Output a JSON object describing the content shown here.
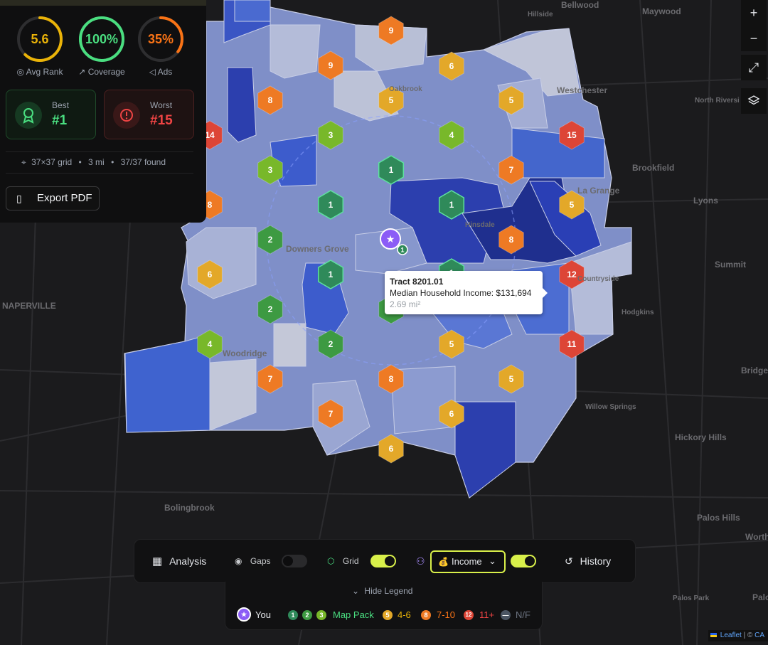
{
  "map": {
    "place_labels": [
      {
        "text": "Bellwood",
        "small": false
      },
      {
        "text": "Maywood",
        "small": false
      },
      {
        "text": "Hillside",
        "small": true
      },
      {
        "text": "Westchester",
        "small": false
      },
      {
        "text": "North Riversi",
        "small": true
      },
      {
        "text": "Brookfield",
        "small": false
      },
      {
        "text": "La Grange",
        "small": false
      },
      {
        "text": "Lyons",
        "small": false
      },
      {
        "text": "Summit",
        "small": false
      },
      {
        "text": "Hodgkins",
        "small": true
      },
      {
        "text": "NAPERVILLE",
        "small": false
      },
      {
        "text": "Bridgeview",
        "small": false
      },
      {
        "text": "Willow Springs",
        "small": true
      },
      {
        "text": "Hickory Hills",
        "small": false
      },
      {
        "text": "Bolingbrook",
        "small": false
      },
      {
        "text": "Palos Hills",
        "small": false
      },
      {
        "text": "Worth",
        "small": false
      },
      {
        "text": "Palos Park",
        "small": true
      },
      {
        "text": "Palos He",
        "small": false
      },
      {
        "text": "Downers Grove",
        "small": false
      },
      {
        "text": "Woodridge",
        "small": false
      },
      {
        "text": "Oakbrook",
        "small": true
      },
      {
        "text": "Countryside",
        "small": true
      },
      {
        "text": "Hinsdale",
        "small": true
      }
    ],
    "markers": [
      {
        "rank": "9"
      },
      {
        "rank": "9"
      },
      {
        "rank": "6"
      },
      {
        "rank": "8"
      },
      {
        "rank": "5"
      },
      {
        "rank": "5"
      },
      {
        "rank": "14"
      },
      {
        "rank": "3"
      },
      {
        "rank": "4"
      },
      {
        "rank": "15"
      },
      {
        "rank": "3"
      },
      {
        "rank": "1"
      },
      {
        "rank": "7"
      },
      {
        "rank": "8"
      },
      {
        "rank": "1"
      },
      {
        "rank": "1"
      },
      {
        "rank": "5"
      },
      {
        "rank": "2"
      },
      {
        "rank": "8"
      },
      {
        "rank": "6"
      },
      {
        "rank": "1"
      },
      {
        "rank": "12"
      },
      {
        "rank": "2"
      },
      {
        "rank": "4"
      },
      {
        "rank": "2"
      },
      {
        "rank": "5"
      },
      {
        "rank": "11"
      },
      {
        "rank": "7"
      },
      {
        "rank": "8"
      },
      {
        "rank": "5"
      },
      {
        "rank": "7"
      },
      {
        "rank": "6"
      },
      {
        "rank": "6"
      },
      {
        "rank": "1"
      },
      {
        "rank": "2"
      }
    ],
    "business_marker": {
      "symbol": "★",
      "badge": "1"
    },
    "tooltip": {
      "title": "Tract 8201.01",
      "line": "Median Household Income: $131,694",
      "area": "2.69 mi²"
    }
  },
  "stats": {
    "avg_rank": {
      "value": "5.6",
      "label": "Avg Rank",
      "fraction": 0.62,
      "color": "#eab308",
      "icon": "target-icon"
    },
    "coverage": {
      "value": "100%",
      "label": "Coverage",
      "fraction": 1.0,
      "color": "#4ade80",
      "icon": "trend-icon"
    },
    "ads": {
      "value": "35%",
      "label": "Ads",
      "fraction": 0.35,
      "color": "#f97316",
      "icon": "megaphone-icon"
    }
  },
  "best": {
    "label": "Best",
    "value": "#1",
    "color": "#4ade80"
  },
  "worst": {
    "label": "Worst",
    "value": "#15",
    "color": "#ef4444"
  },
  "meta": {
    "grid": "37×37 grid",
    "radius": "3 mi",
    "found": "37/37 found"
  },
  "export_label": "Export PDF",
  "controls": {
    "zoom_in": "+",
    "zoom_out": "−"
  },
  "toolbar": {
    "analysis": "Analysis",
    "gaps": "Gaps",
    "gaps_on": false,
    "grid": "Grid",
    "grid_on": true,
    "income": "Income",
    "income_icon": "💰",
    "income_on": true,
    "history": "History"
  },
  "legend": {
    "toggle": "Hide Legend",
    "you": "You",
    "map_pack": "Map Pack",
    "r46": "4-6",
    "r710": "7-10",
    "r11": "11+",
    "nf": "N/F",
    "chips": {
      "c1": "1",
      "c2": "2",
      "c3": "3",
      "c46": "5",
      "c710": "8",
      "c11": "12",
      "cnf": "—"
    }
  },
  "colors": {
    "green_dark": "#2f8a5a",
    "green": "#3d9a42",
    "lime": "#78b82a",
    "yellow": "#e3a829",
    "orange": "#ee7a24",
    "red": "#dd4536",
    "purple": "#8b5cf6",
    "accent": "#d9f04a"
  },
  "attribution": {
    "leaflet": "Leaflet",
    "sep": " | © ",
    "ca": "CA"
  }
}
